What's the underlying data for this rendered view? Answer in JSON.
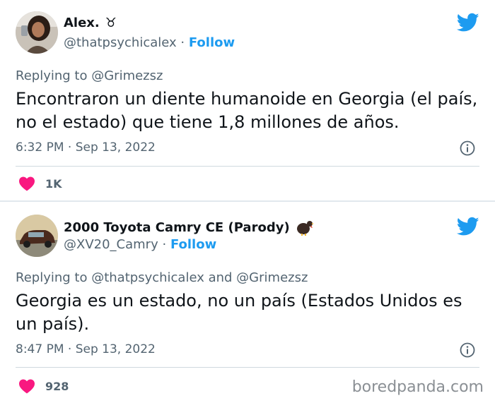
{
  "tweets": [
    {
      "name": "Alex.",
      "name_icon": "♉",
      "handle": "@thatpsychicalex",
      "separator": "·",
      "follow_label": "Follow",
      "replying_prefix": "Replying to",
      "replying_to": "@Grimezsz",
      "text": "Encontraron un diente humanoide en Georgia (el país, no el estado) que tiene 1,8 millones de años.",
      "timestamp": "6:32 PM · Sep 13, 2022",
      "like_count": "1K"
    },
    {
      "name": "2000 Toyota Camry CE (Parody)",
      "name_icon": "turkey-emoji",
      "handle": "@XV20_Camry",
      "separator": "·",
      "follow_label": "Follow",
      "replying_prefix": "Replying to",
      "replying_to": "@thatpsychicalex and @Grimezsz",
      "text": "Georgia es un estado, no un país (Estados Unidos es un país).",
      "timestamp": "8:47 PM · Sep 13, 2022",
      "like_count": "928"
    }
  ],
  "watermark": "boredpanda.com",
  "colors": {
    "twitter_blue": "#1d9bf0",
    "heart": "#f91880",
    "muted": "#536471"
  }
}
